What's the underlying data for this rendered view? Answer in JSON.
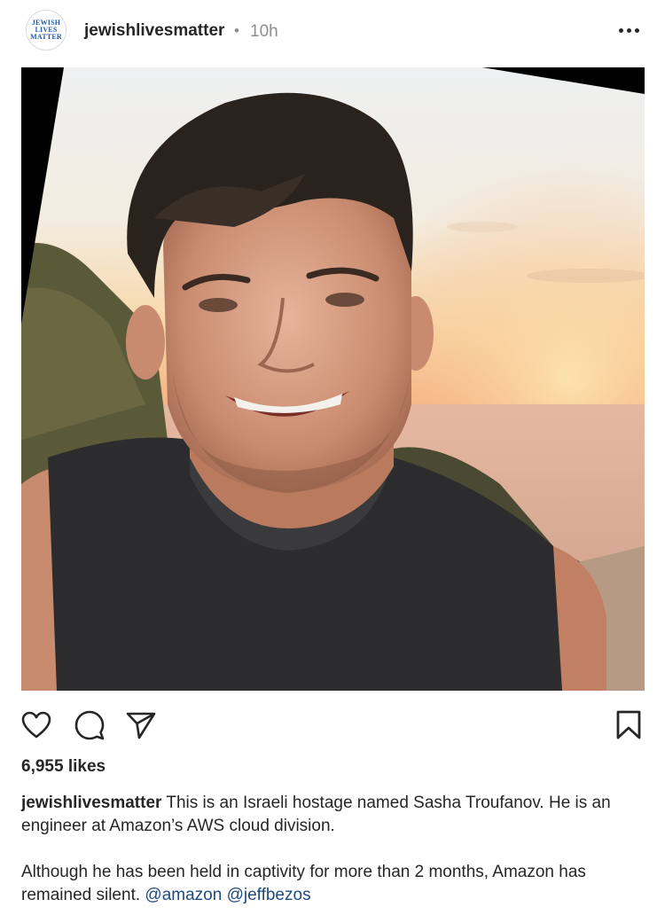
{
  "post": {
    "avatar_text": "JEWISH\nLIVES\nMATTER",
    "username": "jewishlivesmatter",
    "separator": "•",
    "time": "10h",
    "likes": "6,955 likes",
    "caption": {
      "username": "jewishlivesmatter",
      "line1": "This is an Israeli hostage named Sasha Troufanov. He is an engineer at Amazon’s AWS cloud division.",
      "line2": "Although he has been held in captivity for more than 2 months, Amazon has remained silent.",
      "mentions": [
        "@amazon",
        "@jeffbezos"
      ]
    }
  },
  "icons": {
    "more": "more-options-icon",
    "like": "heart-icon",
    "comment": "comment-icon",
    "share": "send-icon",
    "save": "bookmark-icon"
  },
  "colors": {
    "text": "#262626",
    "muted": "#8e8e8e",
    "mention": "#1f4a80",
    "avatar_text": "#1e5aa8"
  }
}
